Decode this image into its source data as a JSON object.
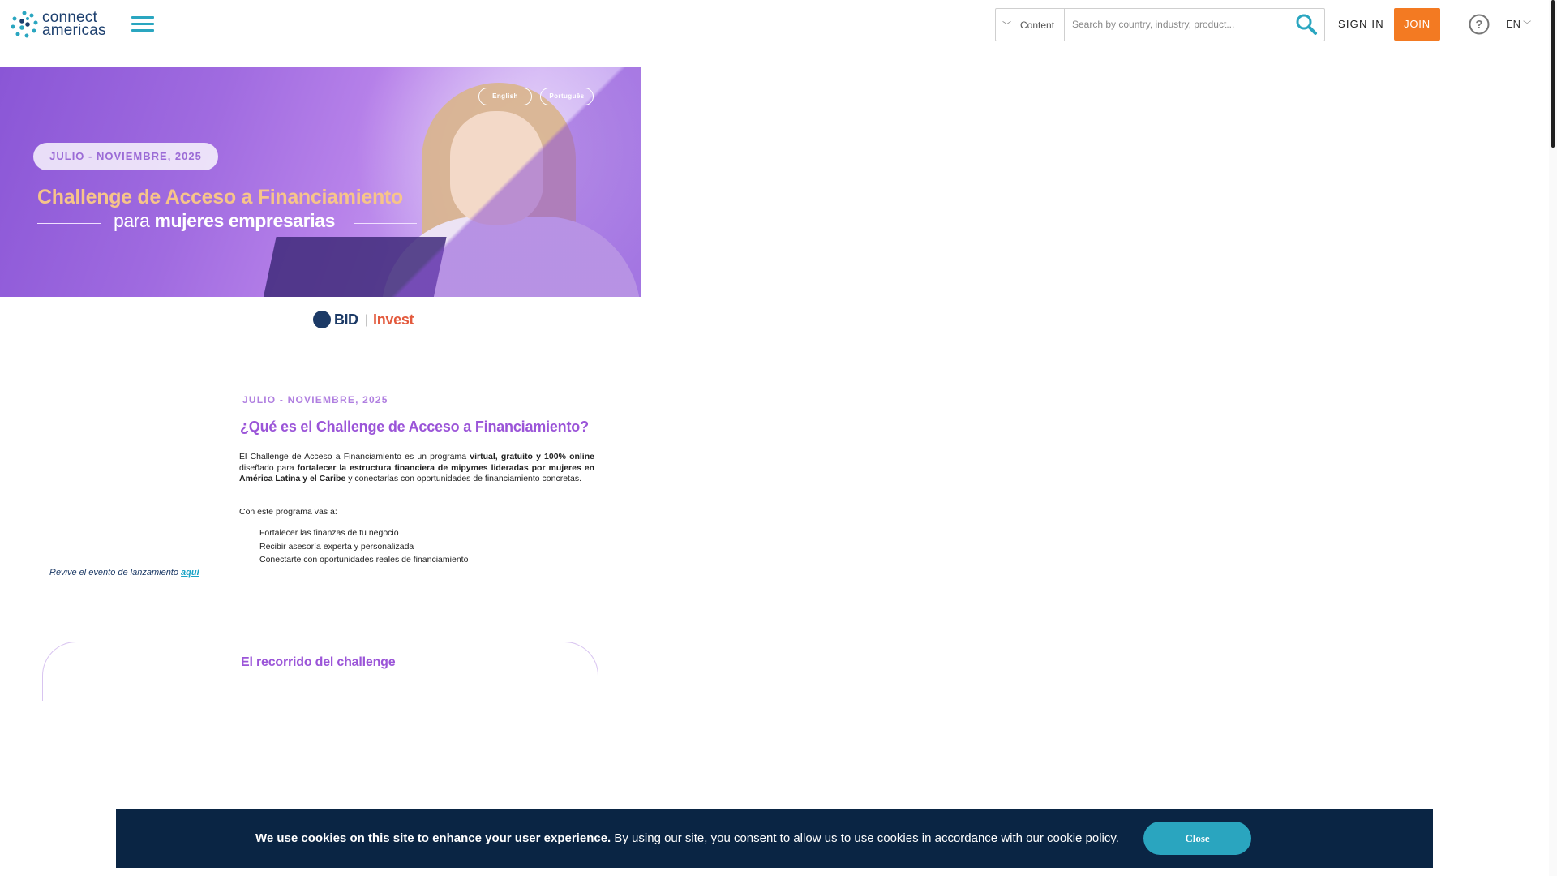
{
  "header": {
    "logo_text_line1": "connect",
    "logo_text_line2": "americas",
    "menu_icon": "hamburger-icon",
    "content_select_label": "Content",
    "search_placeholder": "Search by country, industry, product...",
    "search_icon": "search-icon",
    "sign_in": "SIGN IN",
    "join": "JOIN",
    "help_icon": "help-icon",
    "language": "EN",
    "accent_color": "#2aa6c0",
    "join_color": "#f37a22"
  },
  "hero": {
    "lang_english": "English",
    "lang_portuguese": "Português",
    "date": "JULIO - NOVIEMBRE, 2025",
    "title": "Challenge de Acceso a Financiamiento",
    "subtitle_pre": "para",
    "subtitle_bold": "mujeres empresarias"
  },
  "partner_logo": {
    "bid": "BID",
    "invest": "Invest"
  },
  "about": {
    "kicker": "JULIO - NOVIEMBRE, 2025",
    "heading": "¿Qué es el Challenge de Acceso a Financiamiento?",
    "para_part1": "El Challenge de Acceso a Financiamiento es un programa ",
    "para_bold1": "virtual, gratuito y 100% online",
    "para_part2": " diseñado para ",
    "para_bold2": "fortalecer la estructura financiera de mipymes lideradas por mujeres en América Latina y el Caribe",
    "para_part3": " y conectarlas con oportunidades de financiamiento concretas.",
    "lead": "Con este programa vas a:",
    "bullets": [
      "Fortalecer las finanzas de tu negocio",
      "Recibir asesoría experta y personalizada",
      "Conectarte con oportunidades reales de financiamiento"
    ],
    "revive_text": "Revive el evento de lanzamiento ",
    "revive_link": "aquí"
  },
  "journey": {
    "title": "El recorrido del challenge"
  },
  "cookie": {
    "bold": "We use cookies on this site to enhance your user experience.",
    "text": " By using our site, you consent to allow us to use cookies in accordance with our cookie policy.",
    "close": "Close"
  }
}
